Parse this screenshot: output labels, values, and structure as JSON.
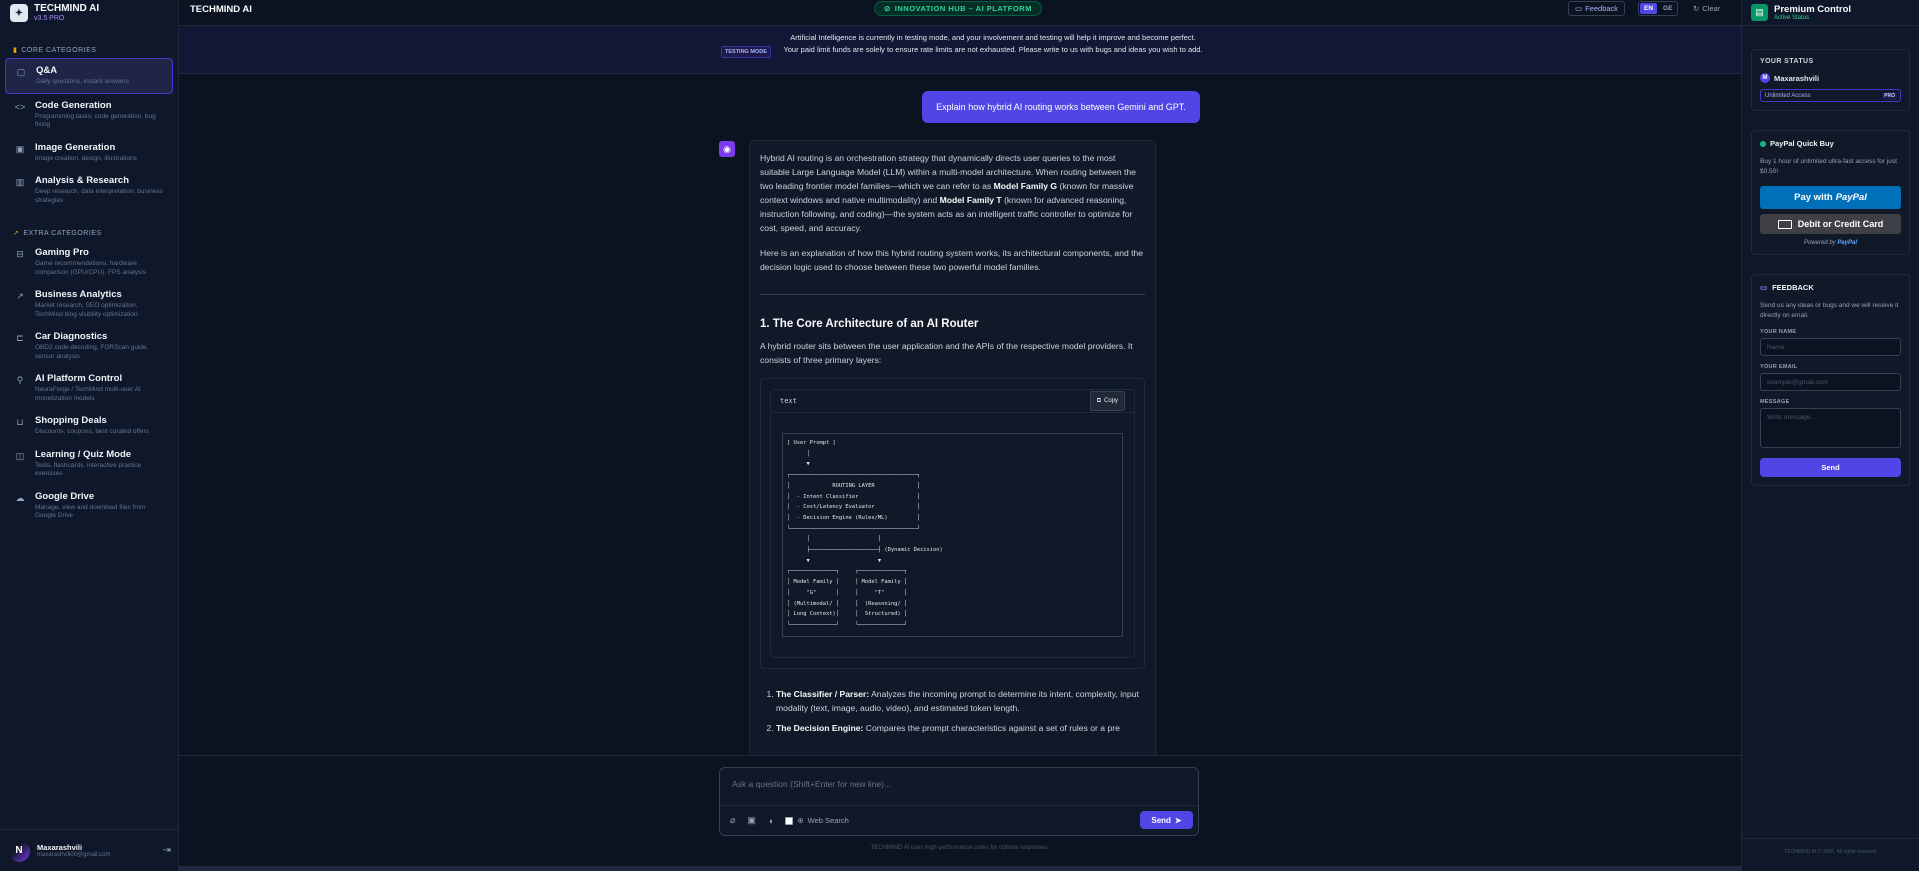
{
  "brand": {
    "name": "TECHMIND AI",
    "version": "v3.5 PRO"
  },
  "sidebar": {
    "core_title": "CORE CATEGORIES",
    "extra_title": "EXTRA CATEGORIES",
    "core": [
      {
        "title": "Q&A",
        "desc": "Daily questions, instant answers"
      },
      {
        "title": "Code Generation",
        "desc": "Programming tasks, code generation, bug fixing"
      },
      {
        "title": "Image Generation",
        "desc": "Image creation, design, illustrations"
      },
      {
        "title": "Analysis & Research",
        "desc": "Deep research, data interpretation, business strategies"
      }
    ],
    "extra": [
      {
        "title": "Gaming Pro",
        "desc": "Game recommendations, hardware comparison (GPU/CPU), FPS analysis"
      },
      {
        "title": "Business Analytics",
        "desc": "Market research, SEO optimization, TechMind blog visibility optimization"
      },
      {
        "title": "Car Diagnostics",
        "desc": "OBD2 code decoding, FORScan guide, sensor analysis"
      },
      {
        "title": "AI Platform Control",
        "desc": "NeuraForge / TechMind multi-user AI monetization models"
      },
      {
        "title": "Shopping Deals",
        "desc": "Discounts, coupons, best curated offers"
      },
      {
        "title": "Learning / Quiz Mode",
        "desc": "Tests, flashcards, interactive practice exercises"
      },
      {
        "title": "Google Drive",
        "desc": "Manage, view and download files from Google Drive"
      }
    ],
    "user": {
      "initial": "N",
      "name": "Maxarashvili",
      "email": "maxarashvili00@gmail.com"
    }
  },
  "topbar": {
    "title": "TECHMIND AI",
    "hub": "INNOVATION HUB – AI PLATFORM",
    "feedback": "Feedback",
    "lang_en": "EN",
    "lang_ge": "GE",
    "clear": "Clear"
  },
  "notice": {
    "tag": "TESTING MODE",
    "text": "Artificial Intelligence is currently in testing mode, and your involvement and testing will help it improve and become perfect. Your paid limit funds are solely to ensure rate limits are not exhausted. Please write to us with bugs and ideas you wish to add."
  },
  "chat": {
    "user_message": "Explain how hybrid AI routing works between Gemini and GPT.",
    "ai": {
      "p1_a": "Hybrid AI routing is an orchestration strategy that dynamically directs user queries to the most suitable Large Language Model (LLM) within a multi-model architecture. When routing between the two leading frontier model families—which we can refer to as ",
      "p1_b": "Model Family G",
      "p1_c": " (known for massive context windows and native multimodality) and ",
      "p1_d": "Model Family T",
      "p1_e": " (known for advanced reasoning, instruction following, and coding)—the system acts as an intelligent traffic controller to optimize for cost, speed, and accuracy.",
      "p2": "Here is an explanation of how this hybrid routing system works, its architectural components, and the decision logic used to choose between these two powerful model families.",
      "h1": "1. The Core Architecture of an AI Router",
      "p3": "A hybrid router sits between the user application and the APIs of the respective model providers. It consists of three primary layers:",
      "code_lang": "text",
      "copy": "Copy",
      "code": "[ User Prompt ]\n      │\n      ▼\n┌───────────────────────────────────────┐\n│             ROUTING LAYER             │\n│  - Intent Classifier                  │\n│  - Cost/Latency Evaluator             │\n│  - Decision Engine (Rules/ML)         │\n└───────────────────────────────────────┘\n      │                     │\n      ├─────────────────────┤ (Dynamic Decision)\n      ▼                     ▼\n┌──────────────┐     ┌──────────────┐\n│ Model Family │     │ Model Family │\n│     \"G\"      │     │     \"T\"      │\n│ (Multimodal/ │     │  (Reasoning/ │\n│ Long Context)│     │  Structured) │\n└──────────────┘     └──────────────┘",
      "li1_b": "The Classifier / Parser:",
      "li1_t": " Analyzes the incoming prompt to determine its intent, complexity, input modality (text, image, audio, video), and estimated token length.",
      "li2_b": "The Decision Engine:",
      "li2_t": " Compares the prompt characteristics against a set of rules or a pre"
    }
  },
  "composer": {
    "placeholder": "Ask a question (Shift+Enter for new line)...",
    "web_search": "Web Search",
    "send": "Send",
    "footnote": "TECHMIND AI uses high-performance cores for optimal responses."
  },
  "rpanel": {
    "title": "Premium Control",
    "subtitle": "Active Status",
    "status_label": "YOUR STATUS",
    "status_initial": "M",
    "status_user": "Maxarashvili",
    "access": "Unlimited Access",
    "pro": "PRO",
    "pp_title": "PayPal Quick Buy",
    "pp_desc": "Buy 1 hour of unlimited ultra-fast access for just $0.50!",
    "pp_btn_a": "Pay with",
    "pp_btn_b": "PayPal",
    "card_btn": "Debit or Credit Card",
    "powered_a": "Powered by",
    "powered_b": "PayPal",
    "fb_title": "FEEDBACK",
    "fb_desc": "Send us any ideas or bugs and we will receive it directly on email.",
    "name_lbl": "YOUR NAME",
    "name_ph": "Name",
    "email_lbl": "YOUR EMAIL",
    "email_ph": "example@gmail.com",
    "msg_lbl": "MESSAGE",
    "msg_ph": "Write message...",
    "send": "Send",
    "footer": "TECHMIND AI © 2026. All rights reserved."
  }
}
